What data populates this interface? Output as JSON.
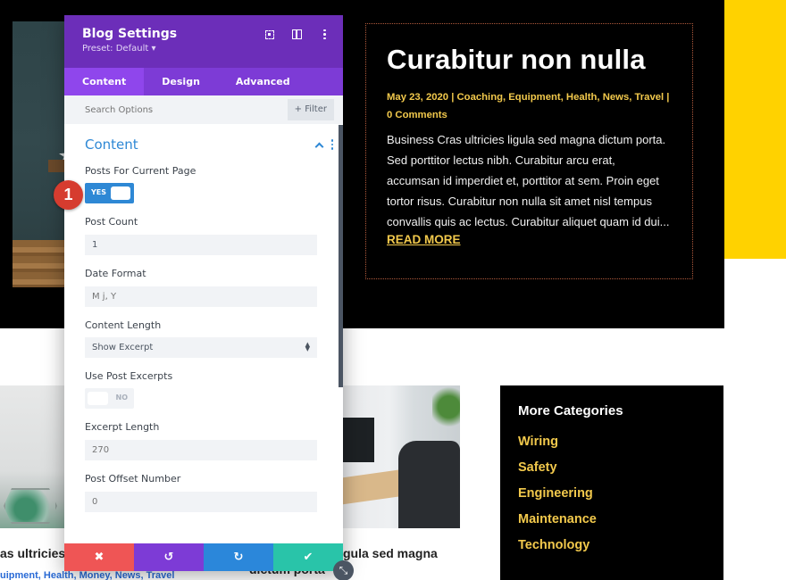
{
  "panel": {
    "title": "Blog Settings",
    "preset": "Preset: Default ▾",
    "header_icons": [
      "expand-icon",
      "split-view-icon",
      "more-options-icon"
    ],
    "tabs": [
      {
        "label": "Content",
        "active": true
      },
      {
        "label": "Design",
        "active": false
      },
      {
        "label": "Advanced",
        "active": false
      }
    ],
    "search_placeholder": "Search Options",
    "filter_label": "+ Filter",
    "section_title": "Content",
    "fields": {
      "posts_for_current_page": {
        "label": "Posts For Current Page",
        "value": "YES"
      },
      "post_count": {
        "label": "Post Count",
        "value": "1"
      },
      "date_format": {
        "label": "Date Format",
        "placeholder": "M j, Y"
      },
      "content_length": {
        "label": "Content Length",
        "value": "Show Excerpt"
      },
      "use_post_excerpts": {
        "label": "Use Post Excerpts",
        "value": "NO"
      },
      "excerpt_length": {
        "label": "Excerpt Length",
        "placeholder": "270"
      },
      "post_offset_number": {
        "label": "Post Offset Number",
        "placeholder": "0"
      }
    },
    "actions": {
      "cancel": "✖",
      "undo": "↺",
      "redo": "↻",
      "save": "✔"
    }
  },
  "badge": "1",
  "featured_post": {
    "title": "Curabitur non nulla",
    "meta_line1": "May 23, 2020 | Coaching, Equipment, Health, News, Travel |",
    "meta_line2": "0 Comments",
    "excerpt": "Business Cras ultricies ligula sed magna dictum porta. Sed porttitor lectus nibh. Curabitur arcu erat, accumsan id imperdiet et, porttitor at sem. Proin eget tortor risus. Curabitur non nulla sit amet nisl tempus convallis quis ac lectus. Curabitur aliquet quam id dui...",
    "read_more": "READ MORE"
  },
  "grid_cards": [
    {
      "title_fragment": "as ultricies",
      "meta_fragment": "uipment, Health, Money, News, Travel"
    },
    {
      "title_fragment": "gula sed magna",
      "title_fragment_2": "dictum porta"
    }
  ],
  "categories": {
    "title": "More Categories",
    "items": [
      "Wiring",
      "Safety",
      "Engineering",
      "Maintenance",
      "Technology"
    ]
  },
  "colors": {
    "accent_purple": "#6c2eb9",
    "accent_blue": "#2e88d5",
    "yellow": "#ffd200",
    "link_yellow": "#f2c94c",
    "cancel_red": "#ef5555",
    "save_teal": "#29c4a9"
  }
}
